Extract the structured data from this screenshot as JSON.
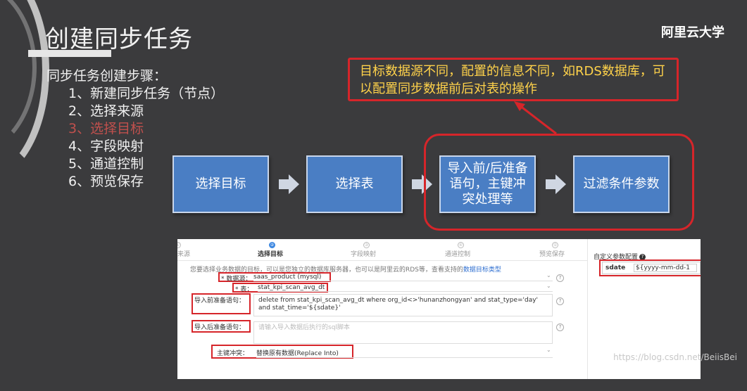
{
  "slide": {
    "title": "创建同步任务",
    "brand": "阿里云大学",
    "steps_heading": "同步任务创建步骤：",
    "steps": [
      "1、新建同步任务（节点）",
      "2、选择来源",
      "3、选择目标",
      "4、字段映射",
      "5、通道控制",
      "6、预览保存"
    ],
    "active_step_index": 2,
    "callout_text": "目标数据源不同，配置的信息不同，如RDS数据库，可以配置同步数据前后对表的操作",
    "flow": [
      "选择目标",
      "选择表",
      "导入前/后准备语句，主键冲突处理等",
      "过滤条件参数"
    ],
    "colors": {
      "background": "#3b3b3d",
      "accent_red": "#d6252a",
      "callout_text": "#ffd24a",
      "flow_box": "#4a7ec4",
      "active_step": "#c0504d"
    }
  },
  "screenshot": {
    "tabs": [
      {
        "num": "①",
        "label": "来源"
      },
      {
        "num": "②",
        "label": "选择目标"
      },
      {
        "num": "③",
        "label": "字段映射"
      },
      {
        "num": "④",
        "label": "通道控制"
      },
      {
        "num": "⑤",
        "label": "预览保存"
      }
    ],
    "active_tab_index": 1,
    "hint": "您要选择业务数据的目标，可以是您独立的数据库服务器，也可以是阿里云的RDS等，查看支持的",
    "hint_link": "数据目标类型",
    "datasource_label": "* 数据源：",
    "datasource_value": "saas_product (mysql)",
    "table_label": "* 表：",
    "table_value": "stat_kpi_scan_avg_dt",
    "pre_sql_label": "导入前准备语句：",
    "pre_sql_value": "delete from  stat_kpi_scan_avg_dt where org_id<>'hunanzhongyan' and stat_type='day' and stat_time='${sdate}'",
    "post_sql_label": "导入后准备语句：",
    "post_sql_placeholder": "请输入导入数据后执行的sql脚本",
    "conflict_label": "主键冲突：",
    "conflict_value": "替换原有数据(Replace Into)",
    "custom_params_title": "自定义参数配置",
    "param_key": "sdate",
    "param_value": "${yyyy-mm-dd-1",
    "watermark": "https://blog.csdn.net/BeiisBei"
  }
}
